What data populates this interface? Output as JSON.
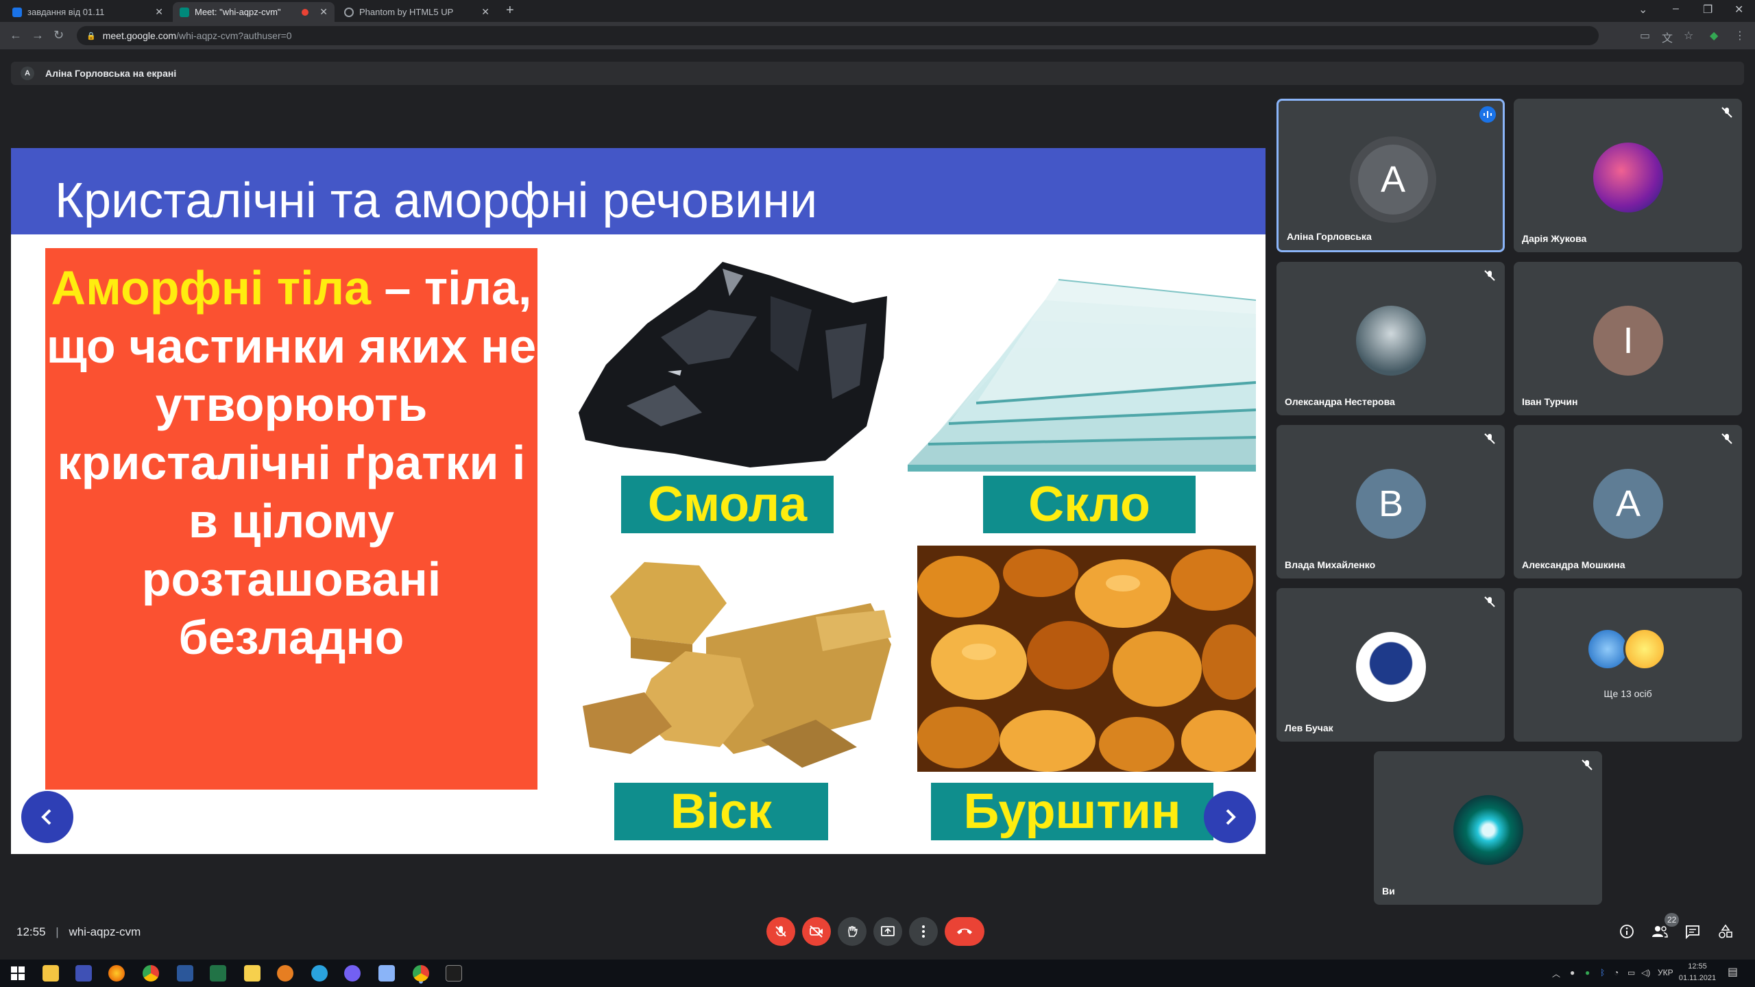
{
  "browser": {
    "tabs": [
      {
        "label": "завдання від 01.11",
        "favicon_color": "#1a73e8"
      },
      {
        "label": "Meet: \"whi-aqpz-cvm\"",
        "favicon_color": "#00897b"
      },
      {
        "label": "Phantom by HTML5 UP",
        "favicon_color": "#9aa0a6"
      }
    ],
    "url_host": "meet.google.com",
    "url_path": "/whi-aqpz-cvm?authuser=0"
  },
  "meet": {
    "presenter_initial": "A",
    "presenter_banner": "Аліна Горловська на екрані",
    "meeting_time": "12:55",
    "meeting_code": "whi-aqpz-cvm",
    "people_count": "22"
  },
  "slide": {
    "title": "Кристалічні та аморфні речовини",
    "definition_highlight": "Аморфні тіла",
    "definition_rest": " – тіла, що частинки яких не утворюють кристалічні ґратки і в цілому розташовані безладно",
    "materials": [
      {
        "label": "Смола"
      },
      {
        "label": "Скло"
      },
      {
        "label": "Віск"
      },
      {
        "label": "Бурштин"
      }
    ]
  },
  "participants": [
    {
      "name": "Аліна Горловська",
      "initial": "A",
      "avatar_color": "#5f6368",
      "speaking": true
    },
    {
      "name": "Дарія Жукова",
      "initial": "",
      "avatar_color": "#7b1fa2"
    },
    {
      "name": "Олександра Нестерова",
      "initial": "",
      "avatar_color": "#455a64"
    },
    {
      "name": "Іван Турчин",
      "initial": "I",
      "avatar_color": "#8d6e63"
    },
    {
      "name": "Влада Михайленко",
      "initial": "B",
      "avatar_color": "#5f7d95"
    },
    {
      "name": "Александра Мошкина",
      "initial": "A",
      "avatar_color": "#5f7d95"
    },
    {
      "name": "Лев Бучак",
      "initial": "",
      "avatar_color": "#ffffff"
    },
    {
      "name": "Ще 13 осіб",
      "initial": "",
      "avatar_color": "#1e88e5"
    },
    {
      "name": "Ви",
      "initial": "",
      "avatar_color": "#0a3d3f"
    }
  ],
  "taskbar": {
    "language": "УКР",
    "time": "12:55",
    "date": "01.11.2021"
  }
}
